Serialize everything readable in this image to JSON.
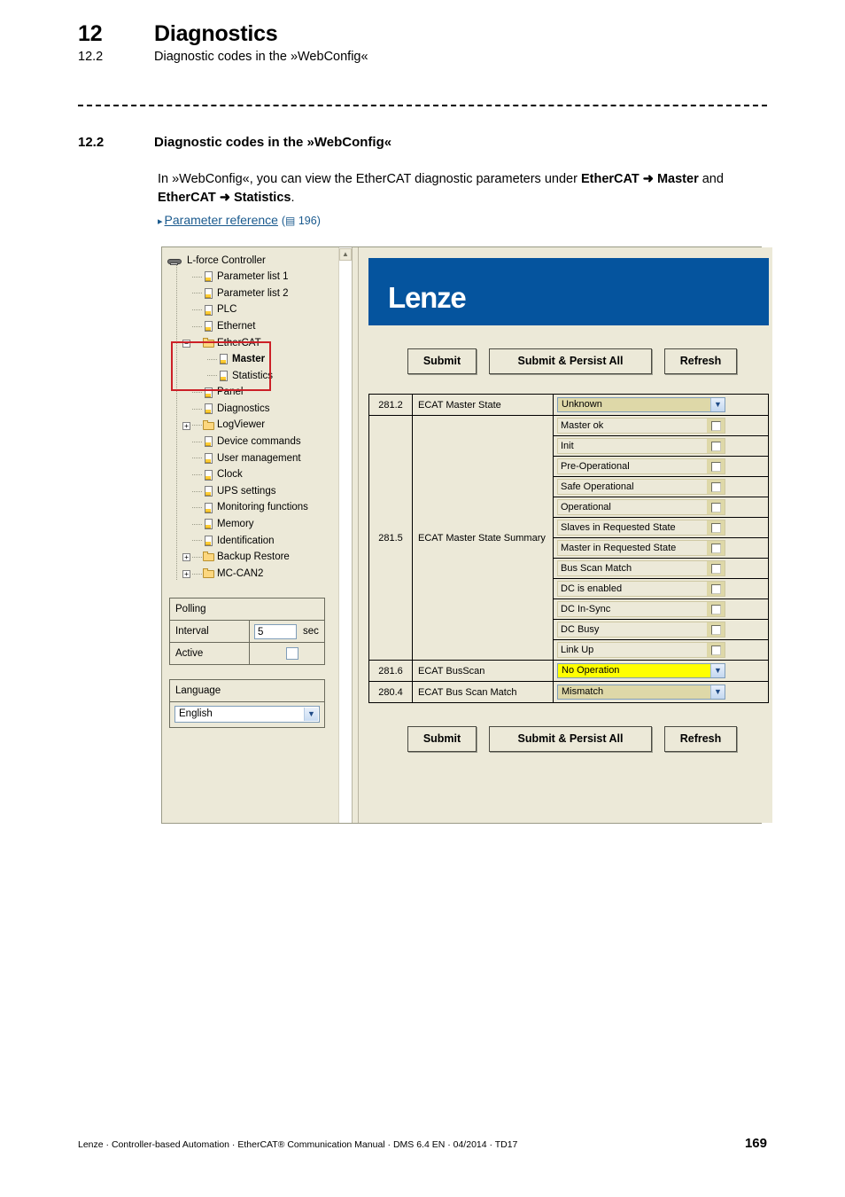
{
  "running_head": {
    "chapter_number": "12",
    "chapter_title": "Diagnostics",
    "section_number": "12.2",
    "section_title": "Diagnostic codes in the »WebConfig«"
  },
  "section": {
    "number": "12.2",
    "title": "Diagnostic codes in the »WebConfig«",
    "paragraph_part1": "In »WebConfig«, you can view the EtherCAT diagnostic parameters under ",
    "paragraph_bold1": "EtherCAT ➜ Master",
    "paragraph_part2": " and ",
    "paragraph_bold2": "EtherCAT ➜ Statistics",
    "paragraph_part3": ".",
    "xref_arrow": "▸",
    "xref_label": "Parameter reference",
    "xref_book_glyph": "▤",
    "xref_page": "196"
  },
  "screenshot": {
    "tree": {
      "nodes": [
        {
          "label": "L-force Controller",
          "icon": "device-icon",
          "indent": 0,
          "toggle": "none",
          "bold": false
        },
        {
          "label": "Parameter list 1",
          "icon": "document-icon",
          "indent": 1,
          "toggle": "none",
          "bold": false
        },
        {
          "label": "Parameter list 2",
          "icon": "document-icon",
          "indent": 1,
          "toggle": "none",
          "bold": false
        },
        {
          "label": "PLC",
          "icon": "document-icon",
          "indent": 1,
          "toggle": "none",
          "bold": false
        },
        {
          "label": "Ethernet",
          "icon": "document-icon",
          "indent": 1,
          "toggle": "none",
          "bold": false
        },
        {
          "label": "EtherCAT",
          "icon": "folder-icon",
          "indent": 1,
          "toggle": "minus",
          "bold": false
        },
        {
          "label": "Master",
          "icon": "document-icon",
          "indent": 2,
          "toggle": "none",
          "bold": true
        },
        {
          "label": "Statistics",
          "icon": "document-icon",
          "indent": 2,
          "toggle": "none",
          "bold": false
        },
        {
          "label": "Panel",
          "icon": "document-icon",
          "indent": 1,
          "toggle": "none",
          "bold": false
        },
        {
          "label": "Diagnostics",
          "icon": "document-icon",
          "indent": 1,
          "toggle": "none",
          "bold": false
        },
        {
          "label": "LogViewer",
          "icon": "folder-icon",
          "indent": 1,
          "toggle": "plus",
          "bold": false
        },
        {
          "label": "Device commands",
          "icon": "document-icon",
          "indent": 1,
          "toggle": "none",
          "bold": false
        },
        {
          "label": "User management",
          "icon": "document-icon",
          "indent": 1,
          "toggle": "none",
          "bold": false
        },
        {
          "label": "Clock",
          "icon": "document-icon",
          "indent": 1,
          "toggle": "none",
          "bold": false
        },
        {
          "label": "UPS settings",
          "icon": "document-icon",
          "indent": 1,
          "toggle": "none",
          "bold": false
        },
        {
          "label": "Monitoring functions",
          "icon": "document-icon",
          "indent": 1,
          "toggle": "none",
          "bold": false
        },
        {
          "label": "Memory",
          "icon": "document-icon",
          "indent": 1,
          "toggle": "none",
          "bold": false
        },
        {
          "label": "Identification",
          "icon": "document-icon",
          "indent": 1,
          "toggle": "none",
          "bold": false
        },
        {
          "label": "Backup Restore",
          "icon": "folder-icon",
          "indent": 1,
          "toggle": "plus",
          "bold": false
        },
        {
          "label": "MC-CAN2",
          "icon": "folder-icon",
          "indent": 1,
          "toggle": "plus",
          "bold": false
        }
      ],
      "highlight_color": "#cc2027"
    },
    "polling": {
      "title": "Polling",
      "interval_label": "Interval",
      "interval_value": "5",
      "interval_unit": "sec",
      "active_label": "Active",
      "active_checked": false
    },
    "language": {
      "title": "Language",
      "selected": "English"
    },
    "brand": {
      "logo_text": "Lenze",
      "bar_color": "#05549e"
    },
    "buttons_top": {
      "submit": "Submit",
      "submit_persist": "Submit & Persist All",
      "refresh": "Refresh"
    },
    "buttons_bottom": {
      "submit": "Submit",
      "submit_persist": "Submit & Persist All",
      "refresh": "Refresh"
    },
    "table": {
      "rows": [
        {
          "code": "281.2",
          "name": "ECAT Master State",
          "value": "Unknown",
          "highlight": false
        },
        {
          "code": "281.5",
          "name": "ECAT Master State Summary",
          "value": null,
          "highlight": false
        },
        {
          "code": "281.6",
          "name": "ECAT BusScan",
          "value": "No Operation",
          "highlight": true
        },
        {
          "code": "280.4",
          "name": "ECAT Bus Scan Match",
          "value": "Mismatch",
          "highlight": false
        }
      ],
      "state_summary_flags": [
        {
          "label": "Master ok",
          "checked": false
        },
        {
          "label": "Init",
          "checked": false
        },
        {
          "label": "Pre-Operational",
          "checked": false
        },
        {
          "label": "Safe Operational",
          "checked": false
        },
        {
          "label": "Operational",
          "checked": false
        },
        {
          "label": "Slaves in Requested State",
          "checked": false
        },
        {
          "label": "Master in Requested State",
          "checked": false
        },
        {
          "label": "Bus Scan Match",
          "checked": false
        },
        {
          "label": "DC is enabled",
          "checked": false
        },
        {
          "label": "DC In-Sync",
          "checked": false
        },
        {
          "label": "DC Busy",
          "checked": false
        },
        {
          "label": "Link Up",
          "checked": false
        }
      ]
    },
    "scrollbar": {
      "up_arrow": "▲"
    }
  },
  "footer": {
    "text": "Lenze · Controller-based Automation · EtherCAT® Communication Manual · DMS 6.4 EN · 04/2014 · TD17",
    "page_number": "169"
  }
}
